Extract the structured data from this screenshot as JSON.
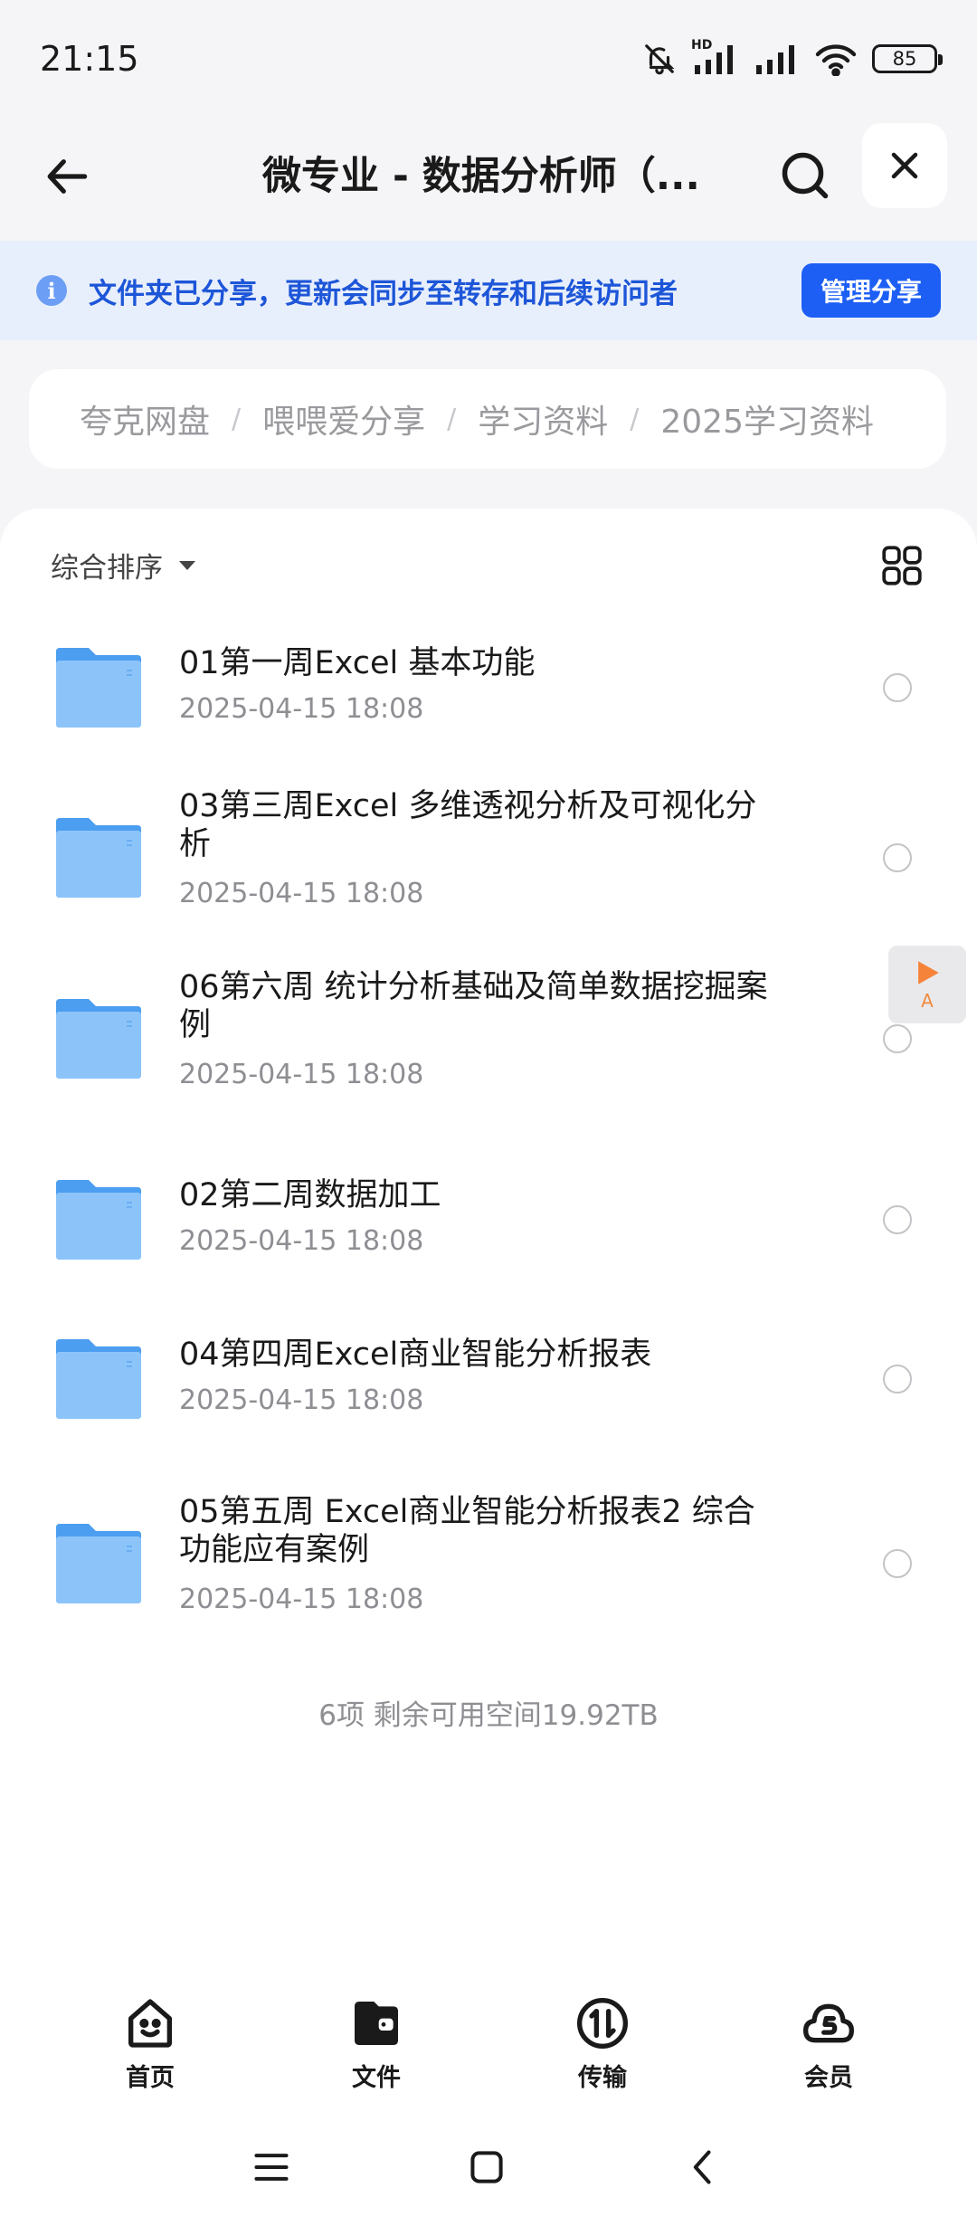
{
  "status_bar": {
    "time": "21:15",
    "network_badge": "HD",
    "battery": "85",
    "icons": [
      "bell-off-icon",
      "signal-icon",
      "signal-icon",
      "wifi-icon",
      "battery-icon"
    ]
  },
  "header": {
    "title": "微专业 - 数据分析师（...",
    "icons": [
      "back-arrow-icon",
      "search-icon",
      "close-icon"
    ]
  },
  "share_banner": {
    "text": "文件夹已分享，更新会同步至转存和后续访问者",
    "button": "管理分享",
    "info_glyph": "i"
  },
  "breadcrumb": {
    "items": [
      "夸克网盘",
      "喂喂爱分享",
      "学习资料",
      "2025学习资料"
    ],
    "separator": "/"
  },
  "sort": {
    "label": "综合排序"
  },
  "files": [
    {
      "name": "01第一周Excel 基本功能",
      "date": "2025-04-15 18:08"
    },
    {
      "name": "03第三周Excel 多维透视分析及可视化分析",
      "date": "2025-04-15 18:08"
    },
    {
      "name": "06第六周 统计分析基础及简单数据挖掘案例",
      "date": "2025-04-15 18:08"
    },
    {
      "name": "02第二周数据加工",
      "date": "2025-04-15 18:08"
    },
    {
      "name": "04第四周Excel商业智能分析报表",
      "date": "2025-04-15 18:08"
    },
    {
      "name": "05第五周 Excel商业智能分析报表2 综合功能应有案例",
      "date": "2025-04-15 18:08"
    }
  ],
  "summary": "6项 剩余可用空间19.92TB",
  "float_button": {
    "letter": "A"
  },
  "tabs": [
    {
      "label": "首页",
      "icon": "smiley-home-icon"
    },
    {
      "label": "文件",
      "icon": "folder-wallet-icon"
    },
    {
      "label": "传输",
      "icon": "transfer-icon"
    },
    {
      "label": "会员",
      "icon": "cloud-member-icon"
    }
  ],
  "colors": {
    "accent": "#1d5ff5",
    "banner_bg": "#e8effc",
    "banner_text": "#1d56d8",
    "folder": "#6cb2f7"
  }
}
